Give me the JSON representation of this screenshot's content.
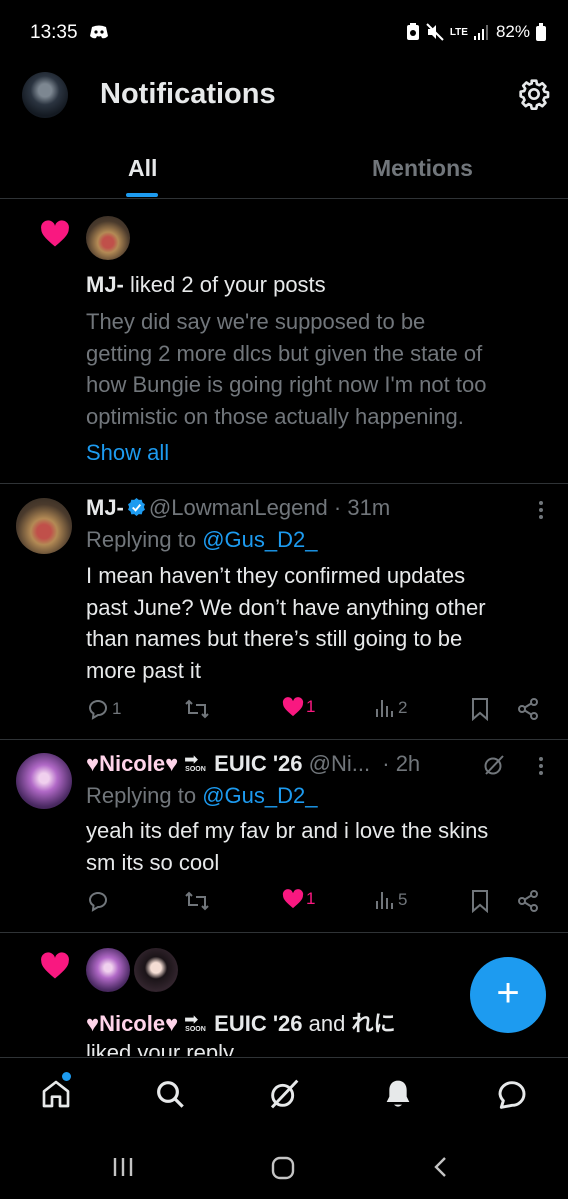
{
  "status_bar": {
    "time": "13:35",
    "network": "LTE",
    "battery": "82%"
  },
  "header": {
    "title": "Notifications"
  },
  "tabs": [
    {
      "label": "All"
    },
    {
      "label": "Mentions"
    }
  ],
  "notifications": [
    {
      "name": "MJ-",
      "action": " liked 2 of your posts",
      "preview_lines": [
        "They did say we're supposed to be",
        "getting 2 more dlcs but given the state of",
        "how Bungie is going right now I'm not too",
        "optimistic on those actually happening."
      ],
      "show_all": "Show all"
    },
    {
      "name": "♥Nicole♥",
      "name_suffix": "EUIC '26",
      "soon_label": "SOON",
      "action_prefix": " and ",
      "other": "れに",
      "action_partial": "liked your reply"
    }
  ],
  "posts": [
    {
      "name": "MJ-",
      "handle": "@LowmanLegend",
      "time": "· 31m",
      "replying_label": "Replying to ",
      "replying_to": "@Gus_D2_",
      "lines": [
        "I mean haven’t they confirmed updates",
        "past June? We don’t have anything other",
        "than names but there’s still going to be",
        "more past it"
      ],
      "replies": "1",
      "likes": "1",
      "views": "2"
    },
    {
      "name": "♥Nicole♥",
      "name_suffix": "EUIC '26",
      "soon_label": "SOON",
      "handle": "@Ni...",
      "time": "· 2h",
      "replying_label": "Replying to ",
      "replying_to": "@Gus_D2_",
      "lines": [
        "yeah its def my fav br and i love the skins",
        "sm its so cool"
      ],
      "likes": "1",
      "views": "5"
    }
  ],
  "colors": {
    "accent": "#1d9bf0",
    "like": "#f91880",
    "muted": "#71767b",
    "text": "#e7e9ea",
    "background": "#000000"
  },
  "icons": [
    "settings-icon",
    "heart-icon",
    "reply-icon",
    "repost-icon",
    "views-icon",
    "bookmark-icon",
    "share-icon",
    "home-icon",
    "search-icon",
    "grok-icon",
    "bell-icon",
    "messages-icon",
    "compose-icon"
  ]
}
